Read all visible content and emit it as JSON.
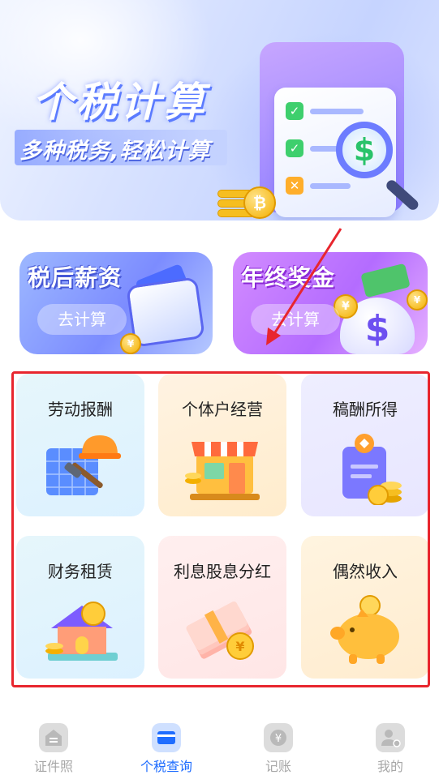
{
  "hero": {
    "title": "个税计算",
    "subtitle": "多种税务,轻松计算"
  },
  "promos": [
    {
      "title": "税后薪资",
      "button": "去计算"
    },
    {
      "title": "年终奖金",
      "button": "去计算"
    }
  ],
  "categories": [
    {
      "label": "劳动报酬",
      "icon": "blueprint-helmet-hammer-icon"
    },
    {
      "label": "个体户经营",
      "icon": "storefront-icon"
    },
    {
      "label": "稿酬所得",
      "icon": "document-badge-coins-icon"
    },
    {
      "label": "财务租赁",
      "icon": "house-coin-icon"
    },
    {
      "label": "利息股息分红",
      "icon": "cash-stack-coin-icon"
    },
    {
      "label": "偶然收入",
      "icon": "piggy-bank-icon"
    }
  ],
  "tabbar": {
    "items": [
      {
        "label": "证件照",
        "icon": "id-photo-icon"
      },
      {
        "label": "个税查询",
        "icon": "card-icon",
        "active": true
      },
      {
        "label": "记账",
        "icon": "yen-ledger-icon"
      },
      {
        "label": "我的",
        "icon": "profile-icon"
      }
    ]
  },
  "colors": {
    "accent": "#1f6dff",
    "annotation": "#e8262e"
  }
}
